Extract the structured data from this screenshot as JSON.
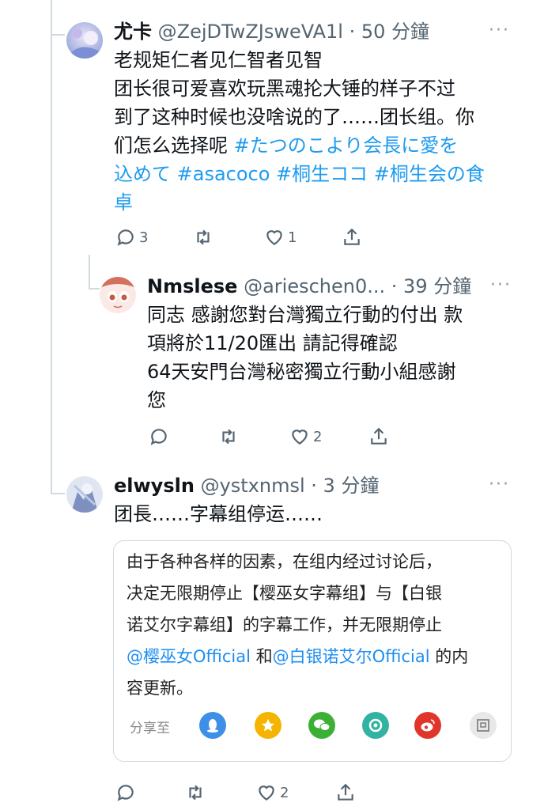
{
  "tweets": [
    {
      "name": "尤卡",
      "handle": "@ZejDTwZJsweVA1l",
      "time": "· 50 分鐘",
      "more": "···",
      "text_lines": [
        "老规矩仁者见仁智者见智",
        "团长很可爱喜欢玩黑魂抡大锤的样子不过",
        "到了这种时候也没啥说的了……团长组。你"
      ],
      "text_line4_plain": "们怎么选择呢 ",
      "text_line4_tag": "#たつのこより会長に愛を",
      "text_line5_tags": "込めて #asacoco #桐生ココ #桐生会の食",
      "text_line6_tag": "卓",
      "actions": {
        "replies": "3",
        "retweets": "",
        "likes": "1"
      }
    },
    {
      "name": "Nmslese",
      "handle": "@arieschen0...",
      "time": "· 39 分鐘",
      "more": "···",
      "text_lines": [
        "同志 感謝您對台灣獨立行動的付出 款",
        "項將於11/20匯出 請記得確認",
        "64天安門台灣秘密獨立行動小組感謝",
        "您"
      ],
      "actions": {
        "replies": "",
        "retweets": "",
        "likes": "2"
      }
    },
    {
      "name": "elwysln",
      "handle": "@ystxnmsl",
      "time": "· 3 分鐘",
      "more": "···",
      "text_lines": [
        "团長……字幕组停运……"
      ],
      "actions": {
        "replies": "",
        "retweets": "",
        "likes": "2"
      }
    }
  ],
  "card": {
    "lines": [
      "由于各种各样的因素，在组内经过讨论后，",
      "决定无限期停止【樱巫女字幕组】与【白银",
      "诺艾尔字幕组】的字幕工作，并无限期停止"
    ],
    "mention1": "@樱巫女Official",
    "and_text": " 和",
    "mention2": "@白银诺艾尔Official",
    "tail": " 的内",
    "last_line": "容更新。",
    "share_label": "分享至",
    "share_icons": [
      {
        "name": "qq-icon",
        "color": "#3d8fe8"
      },
      {
        "name": "qzone-icon",
        "color": "#f4b400"
      },
      {
        "name": "wechat-icon",
        "color": "#3cb034"
      },
      {
        "name": "moments-icon",
        "color": "#32b3a2"
      },
      {
        "name": "weibo-icon",
        "color": "#e0352b"
      },
      {
        "name": "douban-icon",
        "color": "#e8e8e8"
      }
    ]
  },
  "colors": {
    "link": "#1d9bf0",
    "secondary": "#536471",
    "line": "#cfd9de"
  }
}
